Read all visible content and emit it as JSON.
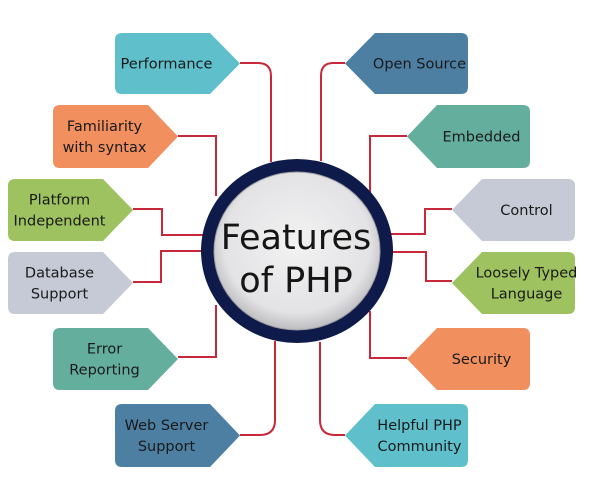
{
  "diagram": {
    "title": "Features of PHP",
    "center": {
      "lines": [
        "Features",
        "of PHP"
      ],
      "ring_color": "#0d1a4a",
      "fill_color": "#e6e6e7"
    },
    "connector_color": "#c8283a",
    "features": [
      {
        "id": "performance",
        "lines": [
          "Performance"
        ],
        "color": "#5fc0cc",
        "side": "left"
      },
      {
        "id": "familiarity-with-syntax",
        "lines": [
          "Familiarity",
          "with syntax"
        ],
        "color": "#f18f5f",
        "side": "left"
      },
      {
        "id": "platform-independent",
        "lines": [
          "Platform",
          "Independent"
        ],
        "color": "#9dc25f",
        "side": "left"
      },
      {
        "id": "database-support",
        "lines": [
          "Database",
          "Support"
        ],
        "color": "#c6cad6",
        "side": "left"
      },
      {
        "id": "error-reporting",
        "lines": [
          "Error",
          "Reporting"
        ],
        "color": "#64ae9e",
        "side": "left"
      },
      {
        "id": "web-server-support",
        "lines": [
          "Web Server",
          "Support"
        ],
        "color": "#4d7fa3",
        "side": "left"
      },
      {
        "id": "open-source",
        "lines": [
          "Open Source"
        ],
        "color": "#4d7fa3",
        "side": "right"
      },
      {
        "id": "embedded",
        "lines": [
          "Embedded"
        ],
        "color": "#64ae9e",
        "side": "right"
      },
      {
        "id": "control",
        "lines": [
          "Control"
        ],
        "color": "#c6cad6",
        "side": "right"
      },
      {
        "id": "loosely-typed-language",
        "lines": [
          "Loosely Typed",
          "Language"
        ],
        "color": "#9dc25f",
        "side": "right"
      },
      {
        "id": "security",
        "lines": [
          "Security"
        ],
        "color": "#f18f5f",
        "side": "right"
      },
      {
        "id": "helpful-php-community",
        "lines": [
          "Helpful PHP",
          "Community"
        ],
        "color": "#5fc0cc",
        "side": "right"
      }
    ]
  }
}
